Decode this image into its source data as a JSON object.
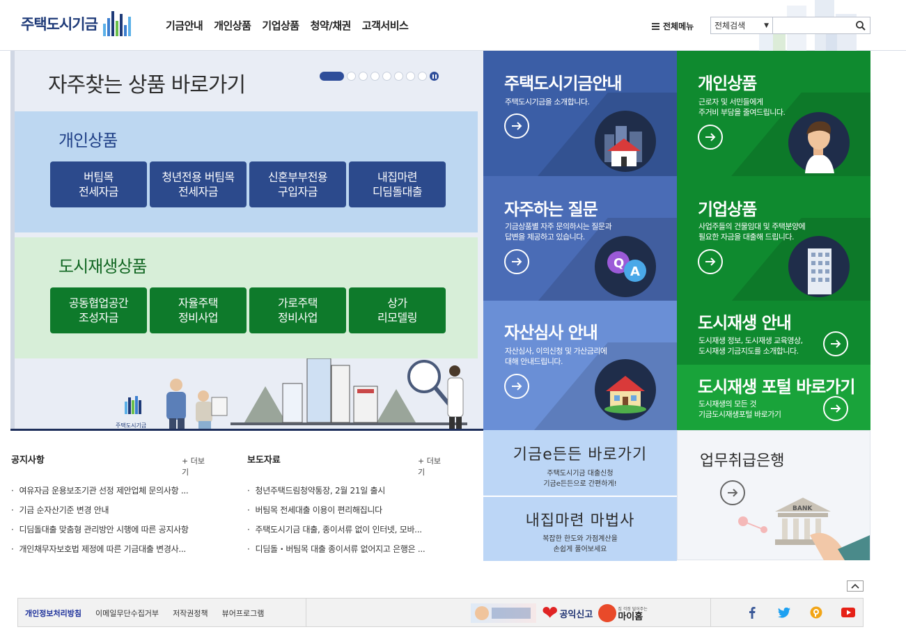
{
  "header": {
    "logo_text": "주택도시기금",
    "nav": [
      "기금안내",
      "개인상품",
      "기업상품",
      "청약/채권",
      "고객서비스"
    ],
    "all_menu": "전체메뉴",
    "search_select": "전체검색",
    "search_placeholder": ""
  },
  "quick": {
    "title": "자주찾는 상품 바로가기",
    "slide_count": 8,
    "active_slide": 1,
    "personal": {
      "title": "개인상품",
      "items": [
        "버팀목\n전세자금",
        "청년전용 버팀목\n전세자금",
        "신혼부부전용\n구입자금",
        "내집마련\n디딤돌대출"
      ]
    },
    "city": {
      "title": "도시재생상품",
      "items": [
        "공동협업공간\n조성자금",
        "자율주택\n정비사업",
        "가로주택\n정비사업",
        "상가\n리모델링"
      ]
    },
    "illus_logo": "주택도시기금"
  },
  "tiles": [
    {
      "title": "주택도시기금안내",
      "desc": "주택도시기금을 소개합니다."
    },
    {
      "title": "개인상품",
      "desc": "근로자 및 서민들에게\n주거비 부담을 줄여드립니다."
    },
    {
      "title": "자주하는 질문",
      "desc": "기금상품별 자주 문의하시는 질문과\n답변을 제공하고 있습니다."
    },
    {
      "title": "기업상품",
      "desc": "사업주들의 건물임대 및 주택분양에\n필요한 자금을 대출해 드립니다."
    },
    {
      "title": "자산심사 안내",
      "desc": "자산심사, 이의신청 및 가산금리에\n대해 안내드립니다."
    },
    {
      "title": "도시재생 안내",
      "desc": "도시재생 정보, 도시재생 교육영상,\n도시재생 기금지도를 소개합니다."
    },
    {
      "title": "도시재생 포털 바로가기",
      "desc": "도시재생의 모든 것\n기금도시재생포털 바로가기"
    }
  ],
  "notice": {
    "title": "공지사항",
    "more": "+ 더보기",
    "items": [
      "여유자금 운용보조기관 선정 제안업체 문의사항 ...",
      "기금 순자산기준 변경 안내",
      "디딤돌대출 맞춤형 관리방안 시행에 따른 공지사항",
      "개인채무자보호법 제정에 따른 기금대출 변경사..."
    ]
  },
  "press": {
    "title": "보도자료",
    "more": "+ 더보기",
    "items": [
      "청년주택드림청약통장, 2월 21일 출시",
      "버팀목 전세대출 이용이 편리해집니다",
      "주택도시기금 대출, 종이서류 없이 인터넷, 모바...",
      "디딤돌・버팀목 대출 종이서류 없어지고 은행은 ..."
    ]
  },
  "quick_links": [
    {
      "title": "기금e든든 바로가기",
      "desc": "주택도시기금 대출신청\n기금e든든으로 간편하게!"
    },
    {
      "title": "내집마련 마법사",
      "desc": "복잡한 한도와 가점계산을\n손쉽게 풀어보세요"
    }
  ],
  "bank": {
    "title": "업무취급은행",
    "sign": "BANK"
  },
  "footer": {
    "links": [
      "개인정보처리방침",
      "이메일무단수집거부",
      "저작권정책",
      "뷰어프로그램"
    ],
    "banners": [
      "공익신고",
      "마이홈"
    ],
    "banner_small": "집 걱정 덜어주는"
  },
  "colors": {
    "navy": "#2c4a8c",
    "green": "#0e7a2b",
    "tile_blue": "#3b5ea6",
    "tile_blue_light": "#6a8fd6",
    "tile_green": "#0f8a2f",
    "tile_green_bright": "#19a33a"
  }
}
